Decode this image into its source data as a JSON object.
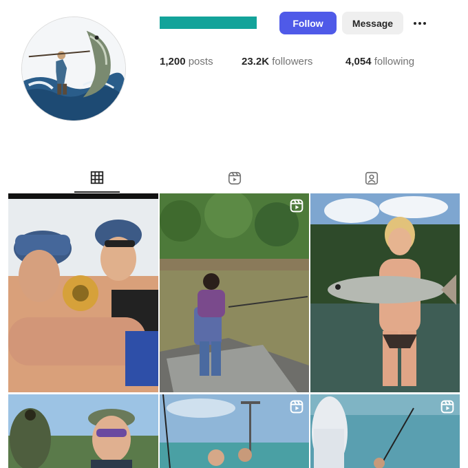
{
  "profile": {
    "username_redacted_color": "#13a39a",
    "follow_label": "Follow",
    "message_label": "Message",
    "more_icon": "more-horizontal-icon"
  },
  "stats": {
    "posts_value": "1,200",
    "posts_label": "posts",
    "followers_value": "23.2K",
    "followers_label": "followers",
    "following_value": "4,054",
    "following_label": "following"
  },
  "tabs": [
    {
      "icon": "grid-icon",
      "active": true
    },
    {
      "icon": "reels-icon",
      "active": false
    },
    {
      "icon": "tagged-icon",
      "active": false
    }
  ],
  "posts": [
    {
      "id": "post-1",
      "reel": false
    },
    {
      "id": "post-2",
      "reel": true
    },
    {
      "id": "post-3",
      "reel": false
    },
    {
      "id": "post-4",
      "reel": false
    },
    {
      "id": "post-5",
      "reel": true
    },
    {
      "id": "post-6",
      "reel": true
    }
  ],
  "colors": {
    "accent": "#4f5ae8",
    "secondary_button": "#efefef",
    "text": "#262626",
    "muted": "#737373"
  }
}
